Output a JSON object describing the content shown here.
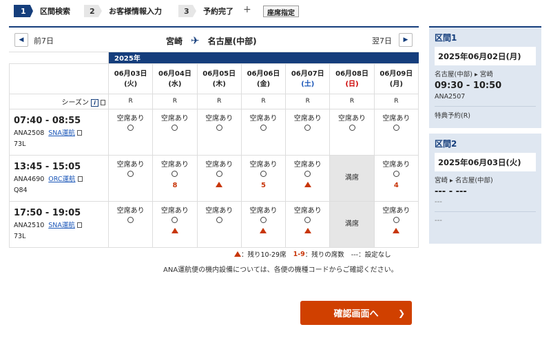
{
  "steps": [
    {
      "num": "1",
      "label": "区間検索"
    },
    {
      "num": "2",
      "label": "お客様情報入力"
    },
    {
      "num": "3",
      "label": "予約完了"
    }
  ],
  "plus": "+",
  "seat_select": "座席指定",
  "nav": {
    "prev": "前7日",
    "next": "翌7日",
    "from": "宮崎",
    "to": "名古屋(中部)"
  },
  "year": "2025年",
  "dates": [
    {
      "d": "06月03日",
      "w": "(火)",
      "type": "normal"
    },
    {
      "d": "06月04日",
      "w": "(水)",
      "type": "normal"
    },
    {
      "d": "06月05日",
      "w": "(木)",
      "type": "normal"
    },
    {
      "d": "06月06日",
      "w": "(金)",
      "type": "normal"
    },
    {
      "d": "06月07日",
      "w": "(土)",
      "type": "sat"
    },
    {
      "d": "06月08日",
      "w": "(日)",
      "type": "sun"
    },
    {
      "d": "06月09日",
      "w": "(月)",
      "type": "normal"
    }
  ],
  "season_label": "シーズン",
  "season": [
    "R",
    "R",
    "R",
    "R",
    "R",
    "R",
    "R"
  ],
  "flights": [
    {
      "time": "07:40 - 08:55",
      "no": "ANA2508",
      "op": "SNA運航",
      "ac": "73L",
      "cells": [
        {
          "label": "空席あり",
          "mark": ""
        },
        {
          "label": "空席あり",
          "mark": ""
        },
        {
          "label": "空席あり",
          "mark": ""
        },
        {
          "label": "空席あり",
          "mark": ""
        },
        {
          "label": "空席あり",
          "mark": ""
        },
        {
          "label": "空席あり",
          "mark": ""
        },
        {
          "label": "空席あり",
          "mark": ""
        }
      ]
    },
    {
      "time": "13:45 - 15:05",
      "no": "ANA4690",
      "op": "ORC運航",
      "ac": "Q84",
      "cells": [
        {
          "label": "空席あり",
          "mark": ""
        },
        {
          "label": "空席あり",
          "mark": "8"
        },
        {
          "label": "空席あり",
          "mark": "tri"
        },
        {
          "label": "空席あり",
          "mark": "5"
        },
        {
          "label": "空席あり",
          "mark": "tri"
        },
        {
          "label": "満席",
          "mark": "full"
        },
        {
          "label": "空席あり",
          "mark": "4"
        }
      ]
    },
    {
      "time": "17:50 - 19:05",
      "no": "ANA2510",
      "op": "SNA運航",
      "ac": "73L",
      "cells": [
        {
          "label": "空席あり",
          "mark": ""
        },
        {
          "label": "空席あり",
          "mark": "tri"
        },
        {
          "label": "空席あり",
          "mark": ""
        },
        {
          "label": "空席あり",
          "mark": "tri"
        },
        {
          "label": "空席あり",
          "mark": "tri"
        },
        {
          "label": "満席",
          "mark": "full"
        },
        {
          "label": "空席あり",
          "mark": "tri"
        }
      ]
    }
  ],
  "legend": {
    "tri": "：残り10-29席",
    "nums": "1-9",
    "nums_text": "：残りの席数",
    "dash": "---：設定なし"
  },
  "notice": "ANA運航便の機内設備については、各便の機種コードからご確認ください。",
  "confirm": "確認画面へ",
  "side": {
    "s1": {
      "title": "区間1",
      "date": "2025年06月02日(月)",
      "route_from": "名古屋(中部)",
      "route_to": "宮崎",
      "time": "09:30 - 10:50",
      "flight": "ANA2507",
      "fare": "特典予約(R)"
    },
    "s2": {
      "title": "区間2",
      "date": "2025年06月03日(火)",
      "route_from": "宮崎",
      "route_to": "名古屋(中部)",
      "time": "--- - ---",
      "dash1": "---",
      "dash2": "---"
    }
  }
}
